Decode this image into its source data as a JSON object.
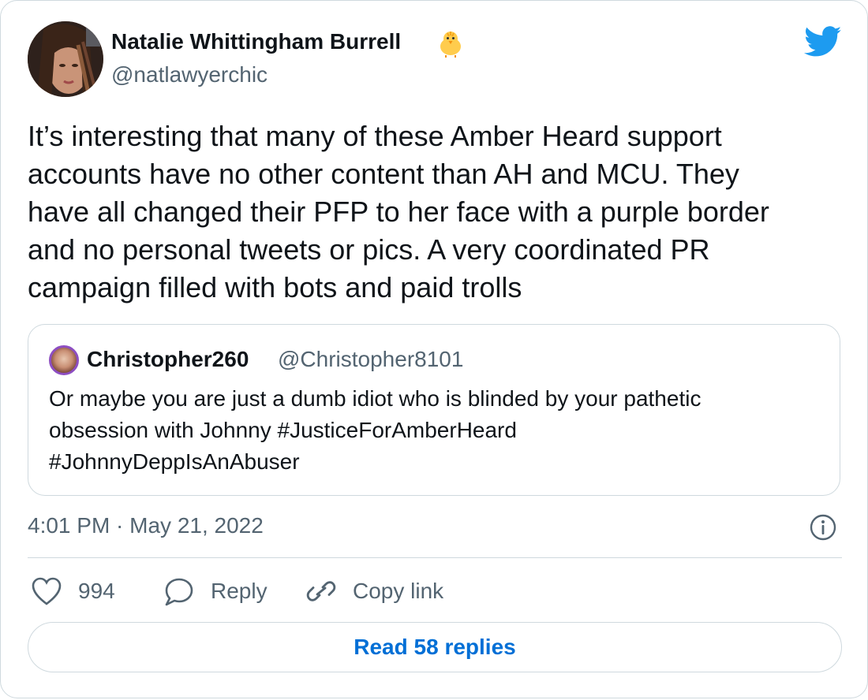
{
  "author": {
    "name": "Natalie Whittingham Burrell",
    "handle": "@natlawyerchic",
    "badge_emoji": "chick-emoji"
  },
  "brand": {
    "logo": "twitter-bird-icon",
    "color": "#1d9bf0"
  },
  "tweet": {
    "text": "It’s interesting that many of these Amber Heard support\naccounts have no other content than AH and MCU. They\nhave all changed their PFP to her face with a purple border\nand no personal tweets or pics. A very coordinated PR\ncampaign filled with bots and paid trolls",
    "timestamp": "4:01 PM · May 21, 2022"
  },
  "quoted_tweet": {
    "name": "Christopher260",
    "handle": "@Christopher8101",
    "text": "Or maybe you are just a dumb idiot who is blinded by your pathetic\nobsession with Johnny #JusticeForAmberHeard\n#JohnnyDeppIsAnAbuser"
  },
  "actions": {
    "like_count": "994",
    "reply_label": "Reply",
    "copy_link_label": "Copy link"
  },
  "read_replies_label": "Read 58 replies",
  "colors": {
    "text": "#0f1419",
    "secondary": "#536471",
    "border": "#cfd9de",
    "link": "#006fd6"
  }
}
